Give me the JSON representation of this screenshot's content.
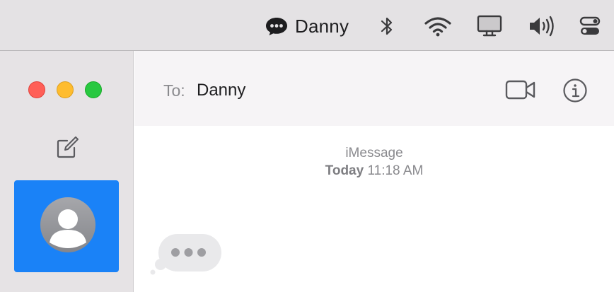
{
  "menubar": {
    "app_icon": "message-bubble-icon",
    "app_name": "Danny",
    "status_icons": [
      "bluetooth-icon",
      "wifi-icon",
      "display-icon",
      "volume-icon",
      "control-center-icon"
    ]
  },
  "window": {
    "traffic_lights": {
      "close_color": "#ff5f57",
      "minimize_color": "#febc2e",
      "zoom_color": "#28c840"
    }
  },
  "sidebar": {
    "compose_icon": "compose-icon",
    "selected_color": "#1a82f7",
    "conversations": [
      {
        "avatar": "person-avatar-icon",
        "selected": true
      }
    ]
  },
  "header": {
    "to_label": "To:",
    "recipient": "Danny",
    "actions": [
      "video-call-icon",
      "info-icon"
    ]
  },
  "transcript": {
    "service": "iMessage",
    "timestamp_day": "Today",
    "timestamp_time": "11:18 AM",
    "typing_indicator": true
  }
}
